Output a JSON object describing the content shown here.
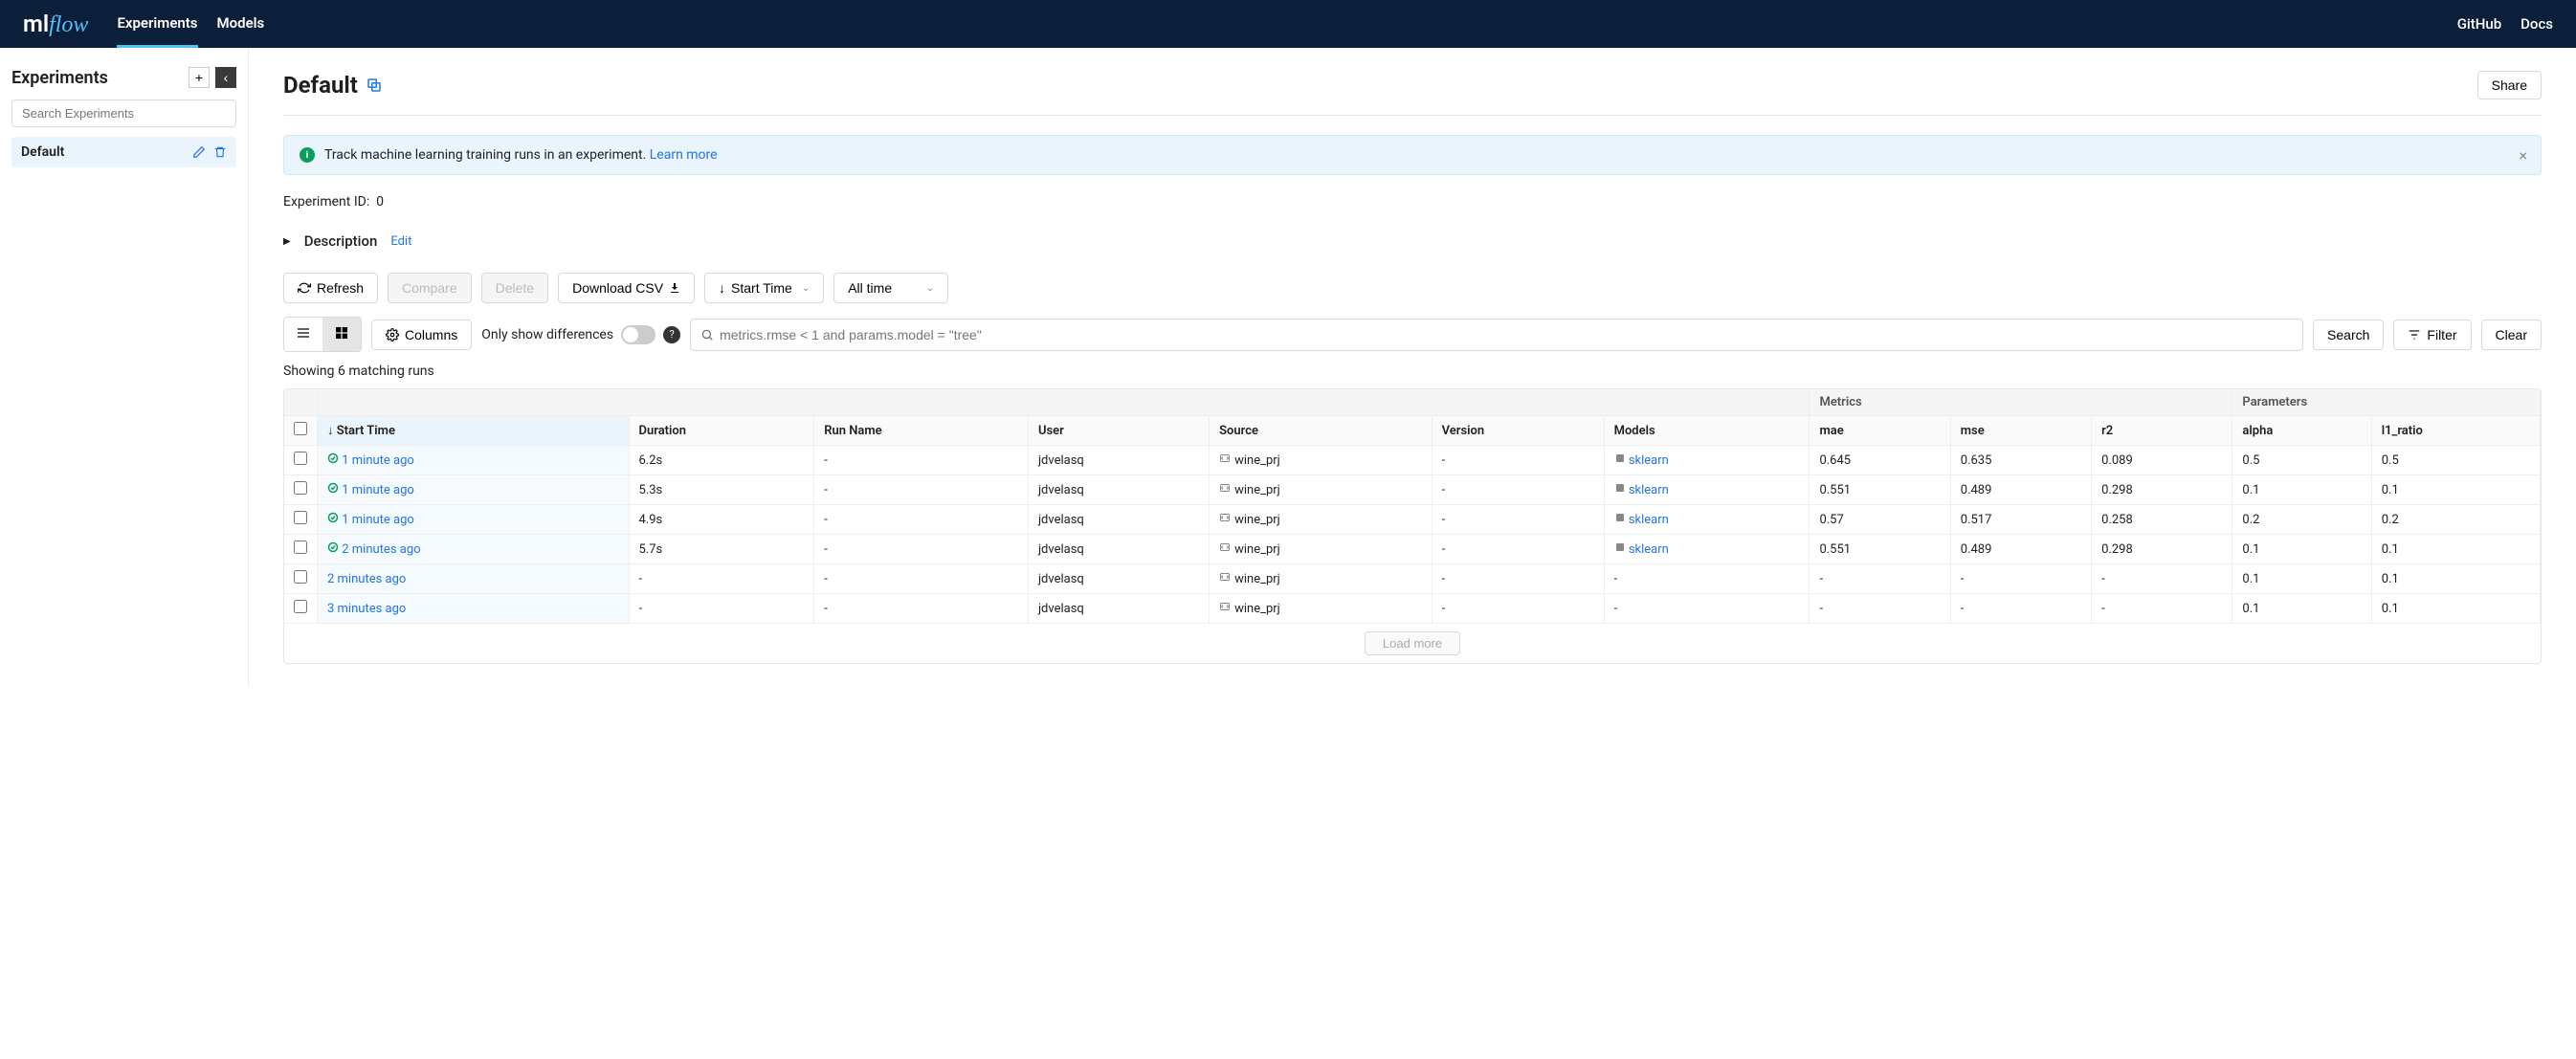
{
  "nav": {
    "tab_experiments": "Experiments",
    "tab_models": "Models",
    "link_github": "GitHub",
    "link_docs": "Docs"
  },
  "sidebar": {
    "title": "Experiments",
    "search_placeholder": "Search Experiments",
    "items": [
      {
        "label": "Default"
      }
    ]
  },
  "header": {
    "title": "Default",
    "share": "Share"
  },
  "alert": {
    "text": "Track machine learning training runs in an experiment. ",
    "learn_more": "Learn more"
  },
  "meta": {
    "exp_id_label": "Experiment ID:",
    "exp_id_value": "0"
  },
  "description": {
    "label": "Description",
    "edit": "Edit"
  },
  "toolbar": {
    "refresh": "Refresh",
    "compare": "Compare",
    "delete": "Delete",
    "download_csv": "Download CSV",
    "sort_by": "Start Time",
    "time_filter": "All time"
  },
  "toolbar2": {
    "columns": "Columns",
    "diff": "Only show differences",
    "search_placeholder": "metrics.rmse < 1 and params.model = \"tree\"",
    "search": "Search",
    "filter": "Filter",
    "clear": "Clear"
  },
  "results": {
    "count_text": "Showing 6 matching runs"
  },
  "table": {
    "group_metrics": "Metrics",
    "group_params": "Parameters",
    "col_start": "Start Time",
    "col_duration": "Duration",
    "col_run_name": "Run Name",
    "col_user": "User",
    "col_source": "Source",
    "col_version": "Version",
    "col_models": "Models",
    "col_mae": "mae",
    "col_mse": "mse",
    "col_r2": "r2",
    "col_alpha": "alpha",
    "col_l1": "l1_ratio",
    "rows": [
      {
        "start": "1 minute ago",
        "status": "ok",
        "duration": "6.2s",
        "run_name": "-",
        "user": "jdvelasq",
        "source": "wine_prj",
        "version": "-",
        "models": "sklearn",
        "mae": "0.645",
        "mse": "0.635",
        "r2": "0.089",
        "alpha": "0.5",
        "l1": "0.5"
      },
      {
        "start": "1 minute ago",
        "status": "ok",
        "duration": "5.3s",
        "run_name": "-",
        "user": "jdvelasq",
        "source": "wine_prj",
        "version": "-",
        "models": "sklearn",
        "mae": "0.551",
        "mse": "0.489",
        "r2": "0.298",
        "alpha": "0.1",
        "l1": "0.1"
      },
      {
        "start": "1 minute ago",
        "status": "ok",
        "duration": "4.9s",
        "run_name": "-",
        "user": "jdvelasq",
        "source": "wine_prj",
        "version": "-",
        "models": "sklearn",
        "mae": "0.57",
        "mse": "0.517",
        "r2": "0.258",
        "alpha": "0.2",
        "l1": "0.2"
      },
      {
        "start": "2 minutes ago",
        "status": "ok",
        "duration": "5.7s",
        "run_name": "-",
        "user": "jdvelasq",
        "source": "wine_prj",
        "version": "-",
        "models": "sklearn",
        "mae": "0.551",
        "mse": "0.489",
        "r2": "0.298",
        "alpha": "0.1",
        "l1": "0.1"
      },
      {
        "start": "2 minutes ago",
        "status": "",
        "duration": "-",
        "run_name": "-",
        "user": "jdvelasq",
        "source": "wine_prj",
        "version": "-",
        "models": "-",
        "mae": "-",
        "mse": "-",
        "r2": "-",
        "alpha": "0.1",
        "l1": "0.1"
      },
      {
        "start": "3 minutes ago",
        "status": "",
        "duration": "-",
        "run_name": "-",
        "user": "jdvelasq",
        "source": "wine_prj",
        "version": "-",
        "models": "-",
        "mae": "-",
        "mse": "-",
        "r2": "-",
        "alpha": "0.1",
        "l1": "0.1"
      }
    ],
    "load_more": "Load more"
  }
}
